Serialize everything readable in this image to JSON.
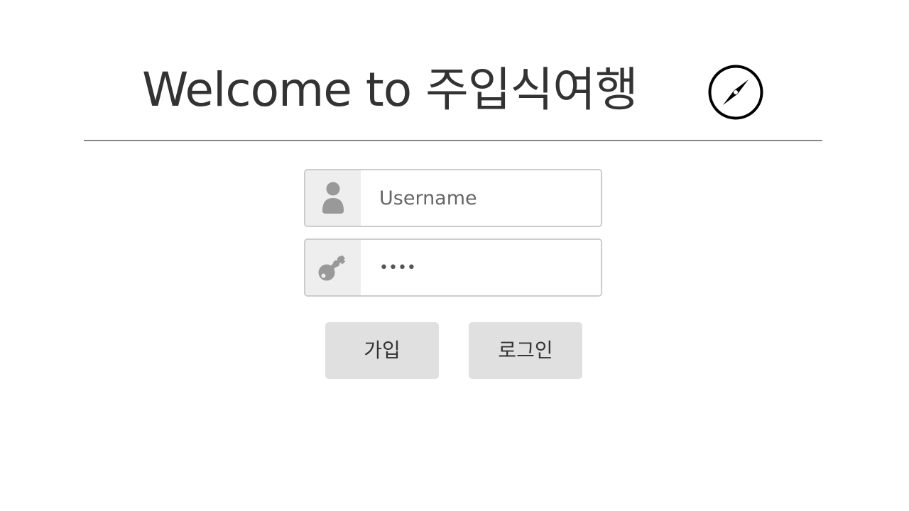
{
  "header": {
    "title": "Welcome to 주입식여행",
    "icon": "compass-icon"
  },
  "form": {
    "username": {
      "icon": "user-icon",
      "value": "",
      "placeholder": "Username"
    },
    "password": {
      "icon": "key-icon",
      "value": "abcd",
      "placeholder": ""
    }
  },
  "buttons": {
    "signup_label": "가입",
    "login_label": "로그인"
  },
  "colors": {
    "text": "#333333",
    "divider": "#888888",
    "icon_gray": "#999999",
    "button_bg": "#e0e0e0",
    "field_border": "#cccccc",
    "icon_cell_bg": "#eeeeee"
  }
}
